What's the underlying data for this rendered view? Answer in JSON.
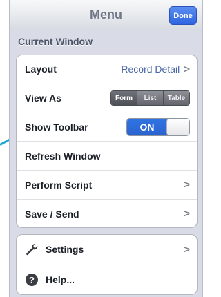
{
  "nav": {
    "title": "Menu",
    "done_label": "Done"
  },
  "section": {
    "current_window": "Current Window"
  },
  "rows": {
    "layout": {
      "label": "Layout",
      "value": "Record Detail",
      "chevron": ">"
    },
    "view_as": {
      "label": "View As",
      "options": [
        "Form",
        "List",
        "Table"
      ],
      "selected": "Form"
    },
    "show_toolbar": {
      "label": "Show Toolbar",
      "state": "ON"
    },
    "refresh_window": {
      "label": "Refresh Window"
    },
    "perform_script": {
      "label": "Perform Script",
      "chevron": ">"
    },
    "save_send": {
      "label": "Save / Send",
      "chevron": ">"
    }
  },
  "extras": {
    "settings": {
      "label": "Settings",
      "icon": "wrench-icon",
      "chevron": ">"
    },
    "help": {
      "label": "Help...",
      "icon": "help-icon"
    }
  },
  "colors": {
    "accent": "#2f64e0",
    "callout": "#1fa6d6",
    "value_text": "#4766a6"
  }
}
